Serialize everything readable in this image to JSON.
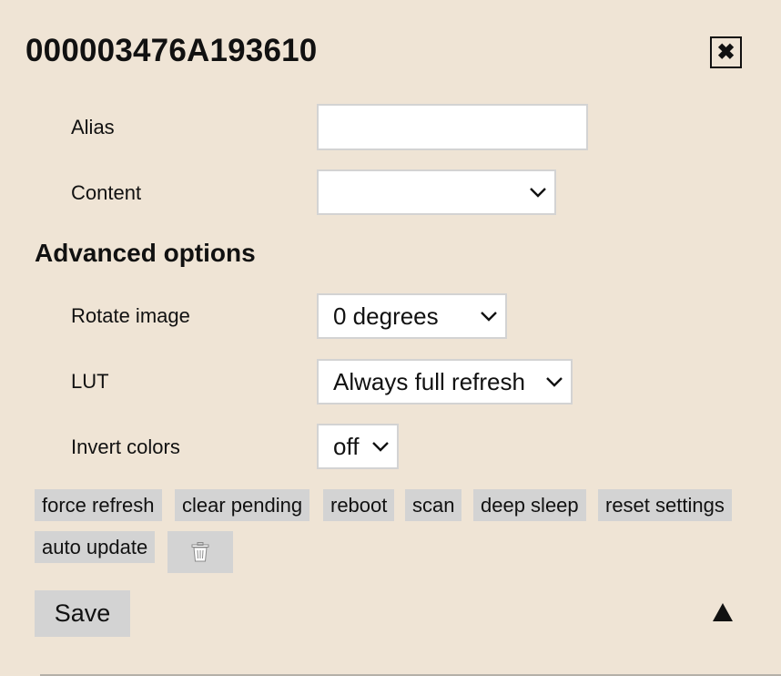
{
  "dialog": {
    "title": "000003476A193610",
    "close_icon": "close-icon"
  },
  "fields": {
    "alias": {
      "label": "Alias",
      "value": ""
    },
    "content": {
      "label": "Content",
      "value": ""
    }
  },
  "advanced": {
    "title": "Advanced options",
    "rotate": {
      "label": "Rotate image",
      "value": "0 degrees"
    },
    "lut": {
      "label": "LUT",
      "value": "Always full refresh"
    },
    "invert": {
      "label": "Invert colors",
      "value": "off"
    }
  },
  "actions": {
    "force_refresh": "force refresh",
    "clear_pending": "clear pending",
    "reboot": "reboot",
    "scan": "scan",
    "deep_sleep": "deep sleep",
    "reset_settings": "reset settings",
    "auto_update": "auto update",
    "delete_icon": "trash-icon"
  },
  "footer": {
    "save_label": "Save",
    "collapse_icon": "triangle-up-icon"
  },
  "colors": {
    "background": "#efe4d5",
    "button": "#d3d3d3",
    "input_border": "#d3d3d3",
    "text": "#111111"
  }
}
